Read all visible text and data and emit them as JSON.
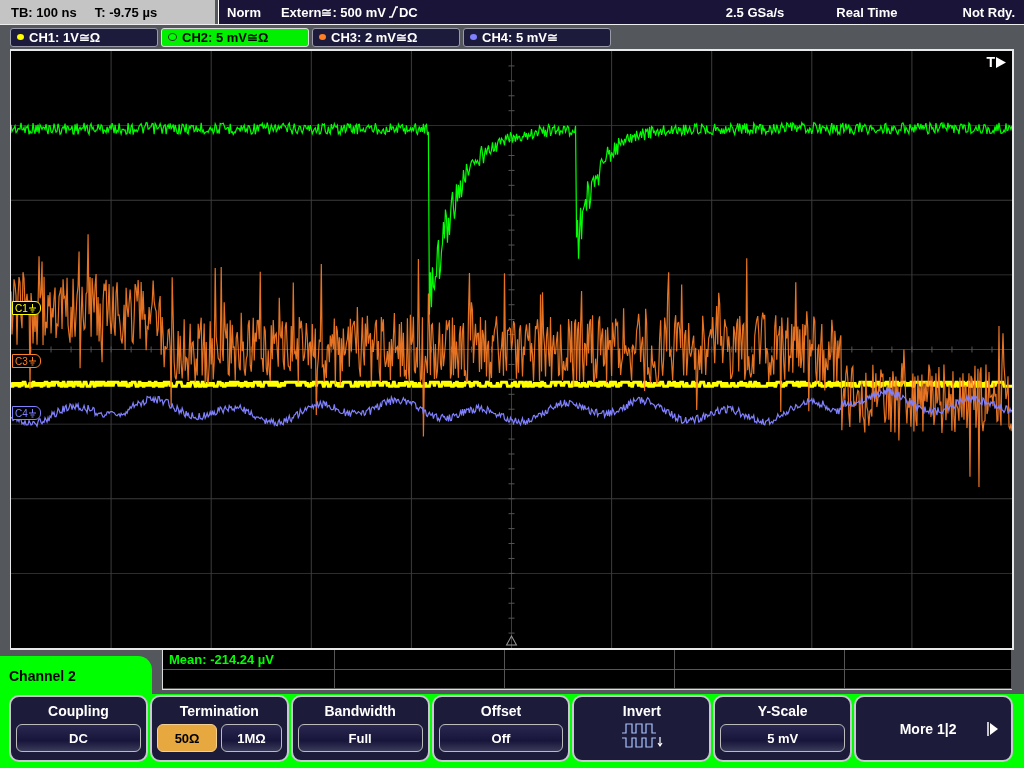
{
  "status_bar": {
    "timebase": "TB: 100 ns",
    "trigger_time": "T: -9.75 µs",
    "trigger_mode": "Norm",
    "trigger_source": "Extern≅: 500 mV",
    "trigger_coupling": "DC",
    "sample_rate": "2.5 GSa/s",
    "acquisition": "Real Time",
    "state": "Not Rdy."
  },
  "channels": [
    {
      "label": "CH1: 1V≅Ω",
      "color": "#ffff00",
      "selected": false
    },
    {
      "label": "CH2: 5 mV≅Ω",
      "color": "#00ff00",
      "selected": true
    },
    {
      "label": "CH3: 2 mV≅Ω",
      "color": "#ff7f27",
      "selected": false
    },
    {
      "label": "CH4: 5 mV≅",
      "color": "#8080ff",
      "selected": false
    }
  ],
  "plot": {
    "trigger_label": "T",
    "markers": [
      {
        "label": "C1",
        "color": "#ffff00"
      },
      {
        "label": "C3",
        "color": "#ff7f27"
      },
      {
        "label": "C4",
        "color": "#8080ff"
      }
    ]
  },
  "measurement": {
    "text": "Mean: -214.24 µV",
    "color": "#00ff00"
  },
  "menu": {
    "title": "Channel 2",
    "softkeys": [
      {
        "kind": "value",
        "label": "Coupling",
        "value": "DC"
      },
      {
        "kind": "options",
        "label": "Termination",
        "options": [
          {
            "label": "50Ω",
            "selected": true
          },
          {
            "label": "1MΩ",
            "selected": false
          }
        ]
      },
      {
        "kind": "value",
        "label": "Bandwidth",
        "value": "Full"
      },
      {
        "kind": "value",
        "label": "Offset",
        "value": "Off"
      },
      {
        "kind": "icon",
        "label": "Invert"
      },
      {
        "kind": "value",
        "label": "Y-Scale",
        "value": "5 mV"
      },
      {
        "kind": "more",
        "label": "More 1|2"
      }
    ]
  }
}
